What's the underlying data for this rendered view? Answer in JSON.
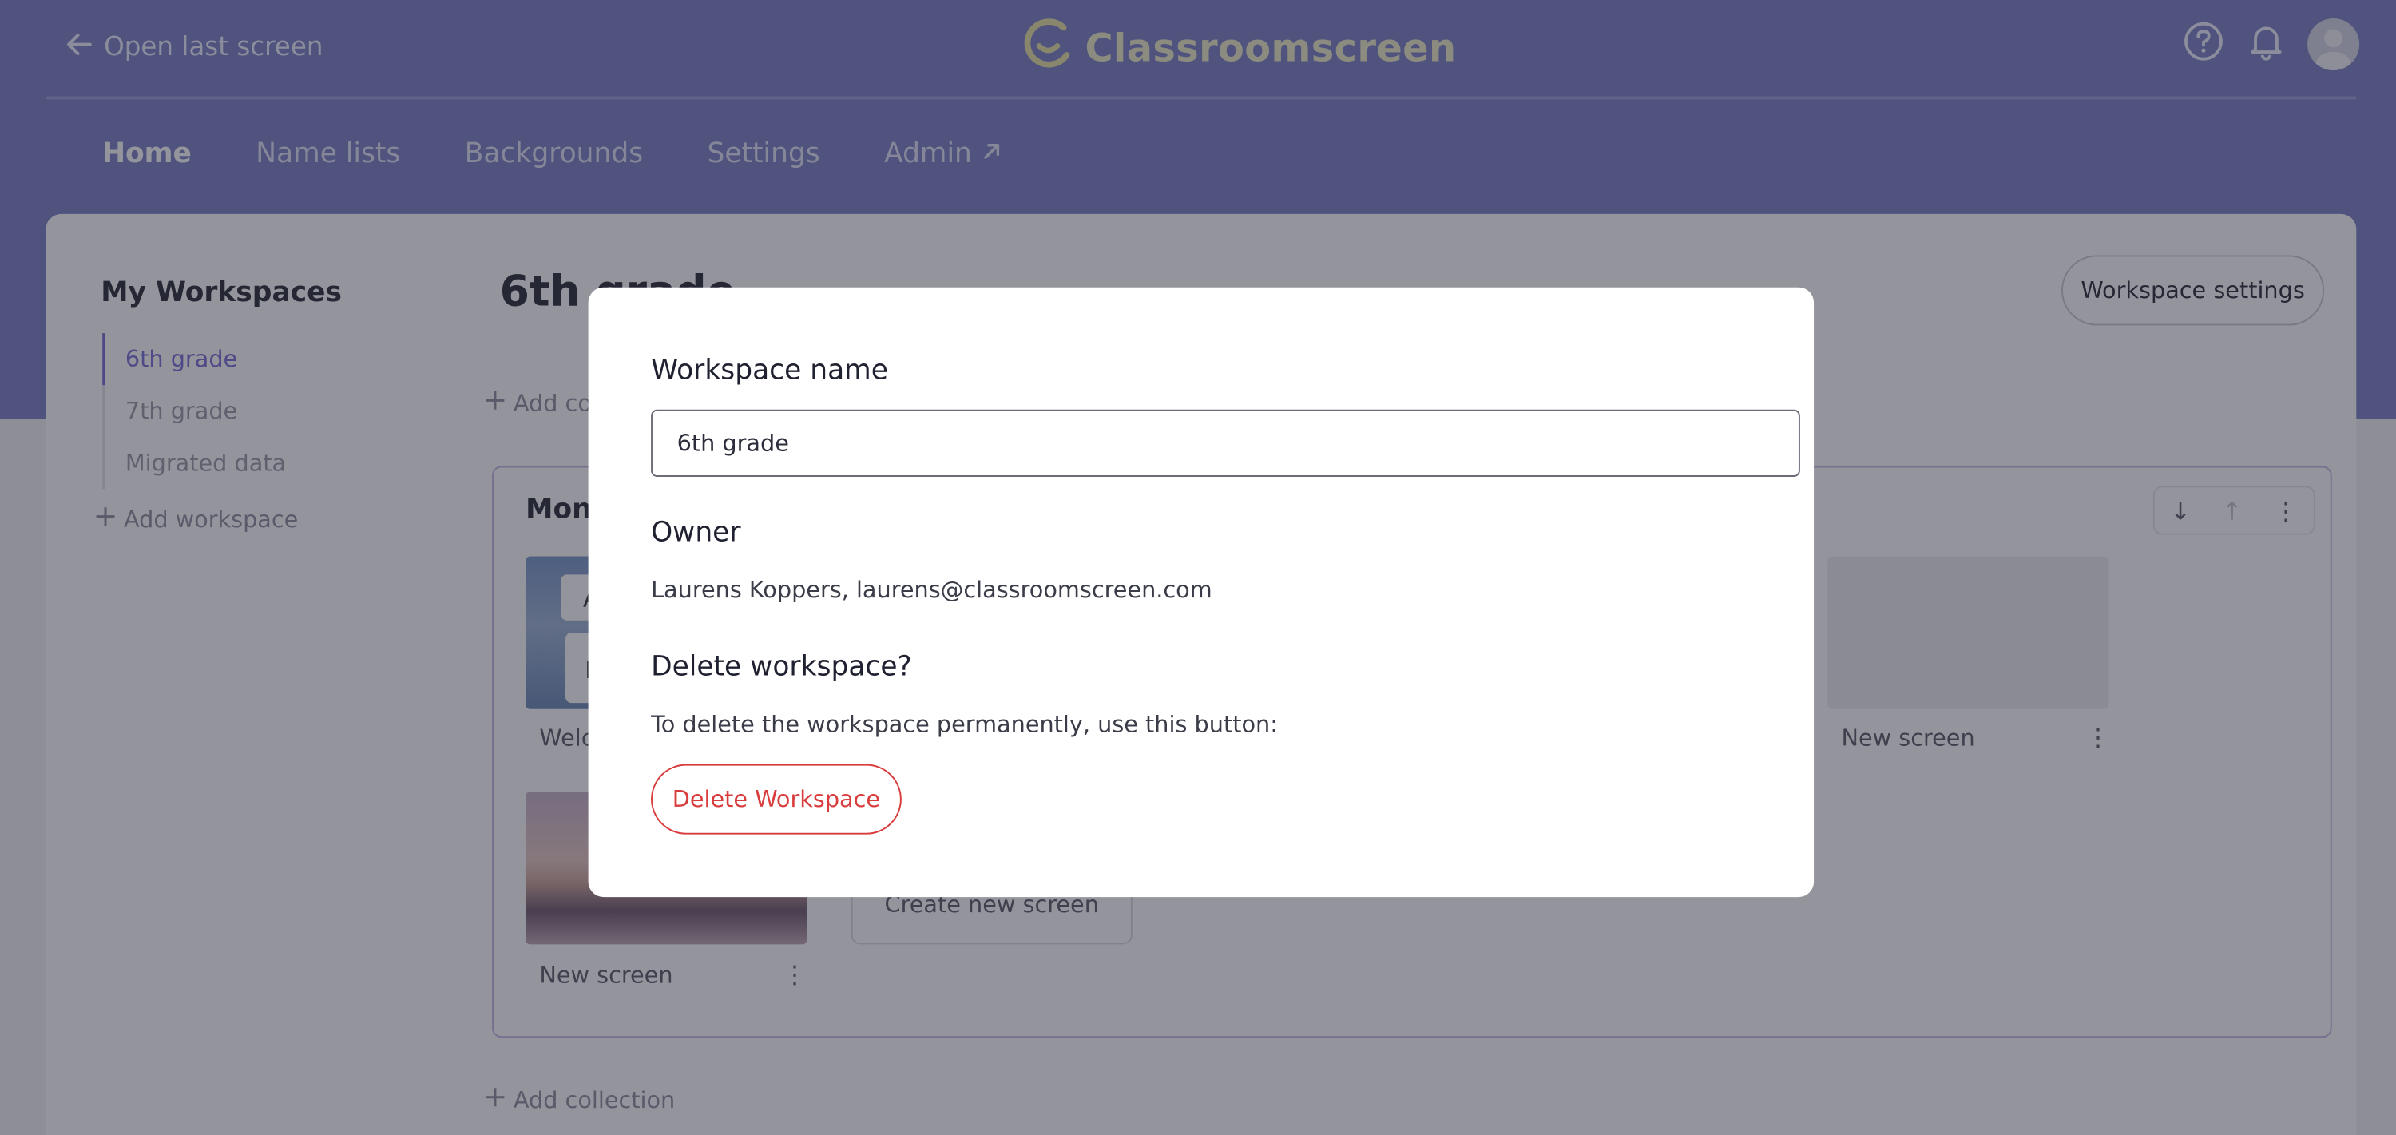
{
  "header": {
    "back_label": "Open last screen",
    "logo_text": "Classroomscreen",
    "brand_color": "#7b80c6",
    "logo_color": "#f0ecc8",
    "icons": [
      "arrow-left-icon",
      "help-icon",
      "bell-icon",
      "avatar"
    ]
  },
  "nav": {
    "items": [
      {
        "label": "Home",
        "active": true
      },
      {
        "label": "Name lists"
      },
      {
        "label": "Backgrounds"
      },
      {
        "label": "Settings"
      },
      {
        "label": "Admin"
      }
    ]
  },
  "sidebar": {
    "title": "My Workspaces",
    "workspaces": [
      {
        "label": "6th grade",
        "active": true
      },
      {
        "label": "7th grade"
      },
      {
        "label": "Migrated data"
      }
    ],
    "add_label": "Add workspace"
  },
  "main": {
    "title": "6th grade",
    "settings_label": "Workspace settings",
    "add_collection_label": "Add collection",
    "collection": {
      "title": "Monday",
      "screens": [
        {
          "label": "Welcome"
        },
        {
          "label": "New screen"
        },
        {
          "label": "New screen"
        }
      ],
      "create_label": "Create new screen"
    }
  },
  "modal": {
    "name_label": "Workspace name",
    "name_value": "6th grade",
    "owner_label": "Owner",
    "owner_value": "Laurens Koppers, laurens@classroomscreen.com",
    "delete_heading": "Delete workspace?",
    "delete_text": "To delete the workspace permanently, use this button:",
    "delete_button": "Delete Workspace",
    "delete_color": "#d83c3c"
  }
}
